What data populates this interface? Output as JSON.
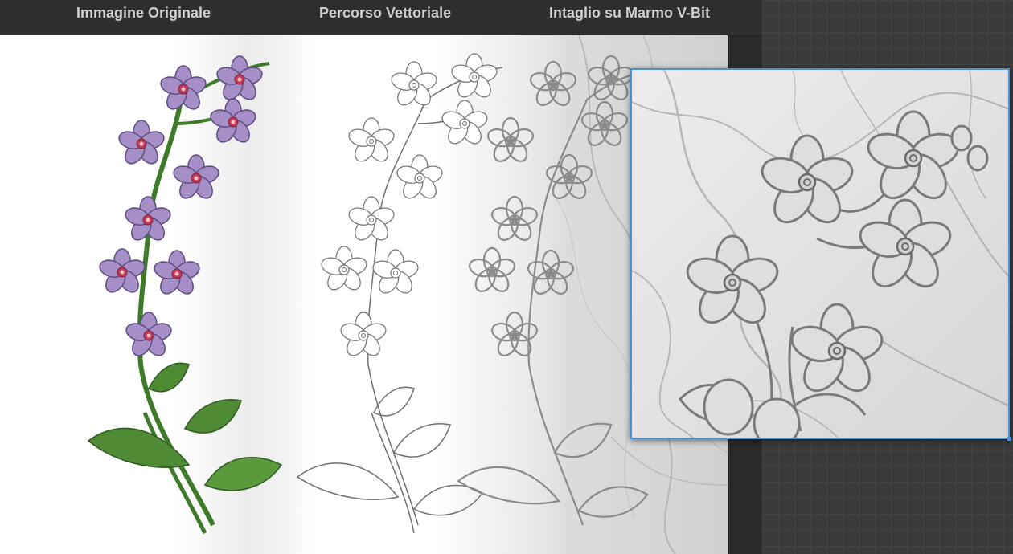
{
  "header": {
    "label_original": "Immagine Originale",
    "label_vector": "Percorso Vettoriale",
    "label_marble": "Intaglio su Marmo V-Bit"
  },
  "colors": {
    "petal": "#a58fc6",
    "petal_edge": "#5d4a80",
    "center": "#c23a5a",
    "leaf": "#4f8a35",
    "leaf_edge": "#2f5a20",
    "vector_line": "#6f6f6f",
    "engrave_line": "#8a8a8a",
    "selection": "#4a8fd1"
  },
  "icons": {
    "flower": "forget-me-not-flower-icon"
  }
}
